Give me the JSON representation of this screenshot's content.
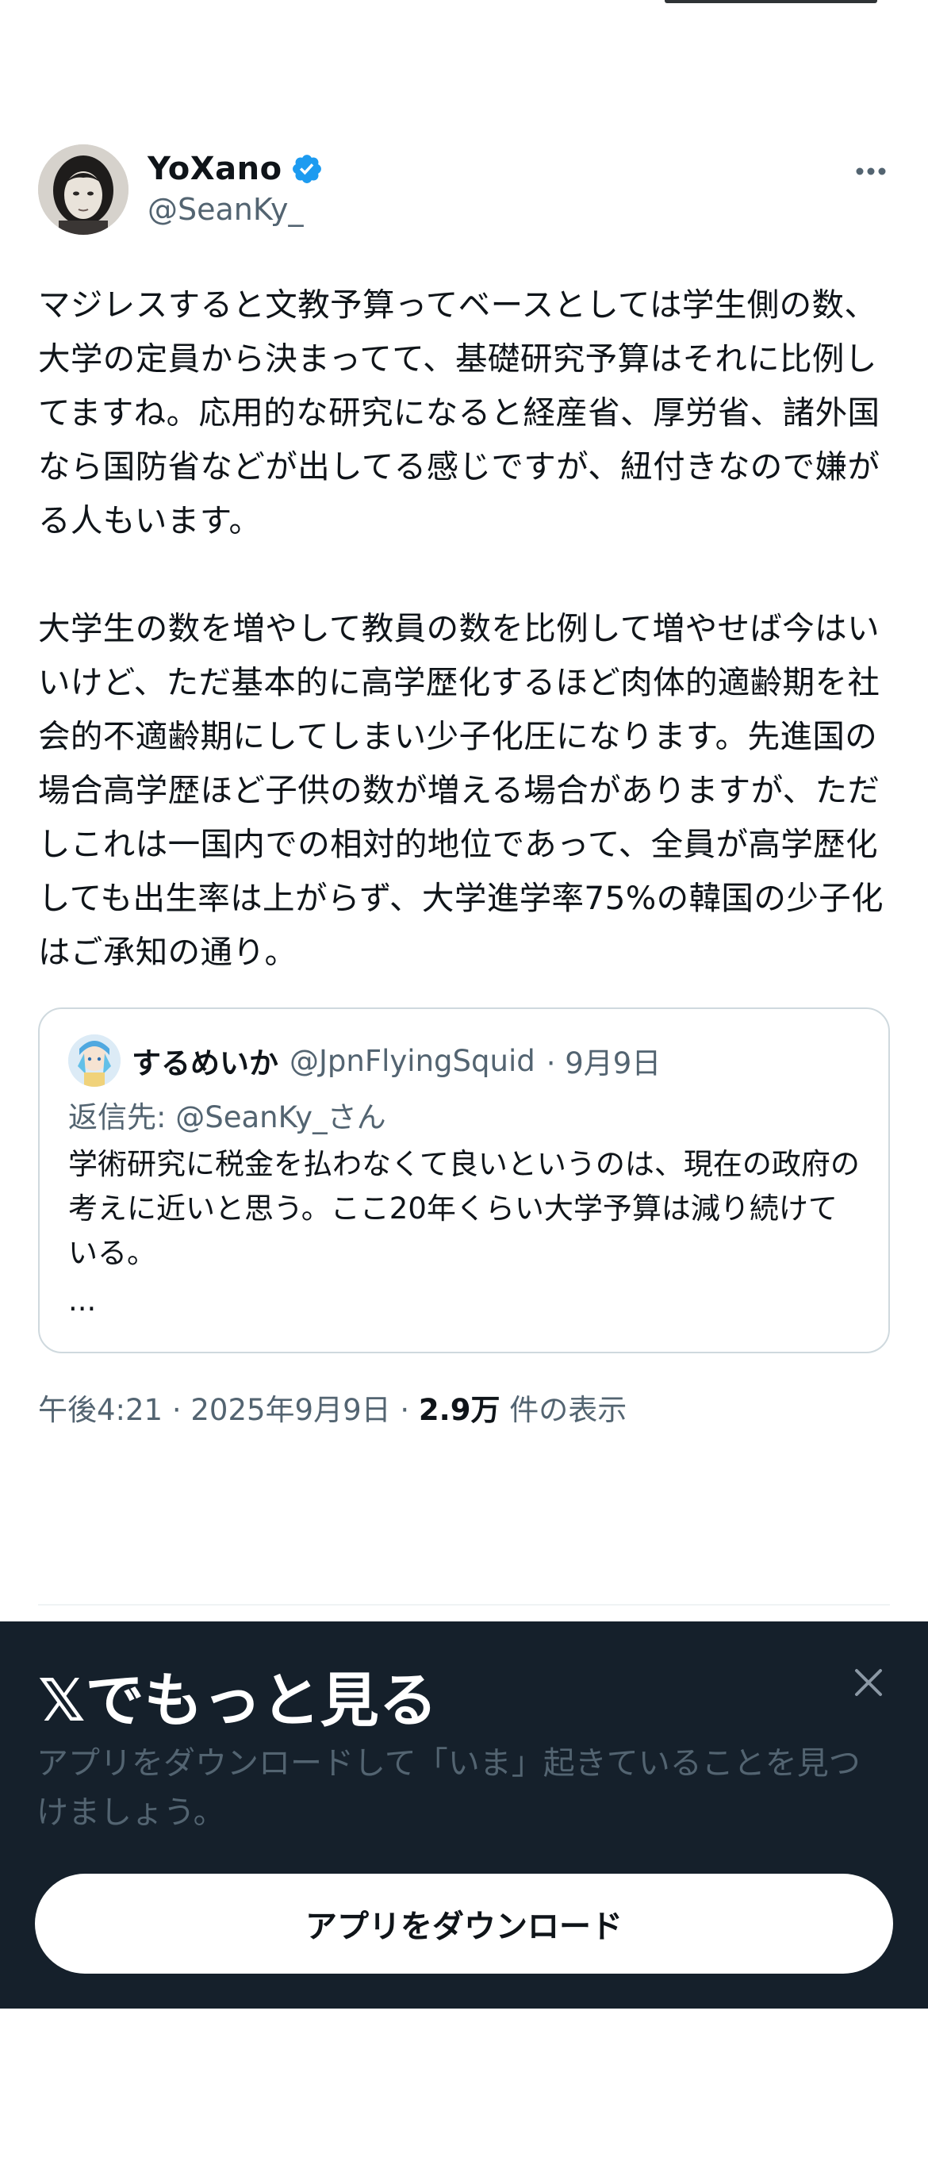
{
  "tweet": {
    "display_name": "YoXano",
    "handle": "@SeanKy_",
    "body": "マジレスすると文教予算ってベースとしては学生側の数、大学の定員から決まってて、基礎研究予算はそれに比例してますね。応用的な研究になると経産省、厚労省、諸外国なら国防省などが出してる感じですが、紐付きなので嫌がる人もいます。\n\n大学生の数を増やして教員の数を比例して増やせば今はいいけど、ただ基本的に高学歴化するほど肉体的適齢期を社会的不適齢期にしてしまい少子化圧になります。先進国の場合高学歴ほど子供の数が増える場合がありますが、ただしこれは一国内での相対的地位であって、全員が高学歴化しても出生率は上がらず、大学進学率75%の韓国の少子化はご承知の通り。",
    "verified_icon": "verified-badge-icon",
    "more_icon": "more-dots-icon"
  },
  "quote": {
    "name": "するめいか",
    "handle": "@JpnFlyingSquid",
    "date": "· 9月9日",
    "reply_prefix": "返信先: ",
    "reply_handle": "@SeanKy_さん",
    "text": "学術研究に税金を払わなくて良いというのは、現在の政府の考えに近いと思う。ここ20年くらい大学予算は減り続けている。",
    "ellipsis": "..."
  },
  "meta": {
    "time": "午後4:21 · 2025年9月9日 · ",
    "views": "2.9万",
    "views_label": " 件の表示"
  },
  "banner": {
    "title": "𝕏でもっと見る",
    "subtitle": "アプリをダウンロードして「いま」起きていることを見つけましょう。",
    "button_label": "アプリをダウンロード",
    "close_icon": "close-icon"
  },
  "colors": {
    "verified": "#1d9bf0",
    "banner_bg": "#15202b",
    "secondary_text": "#536471"
  }
}
